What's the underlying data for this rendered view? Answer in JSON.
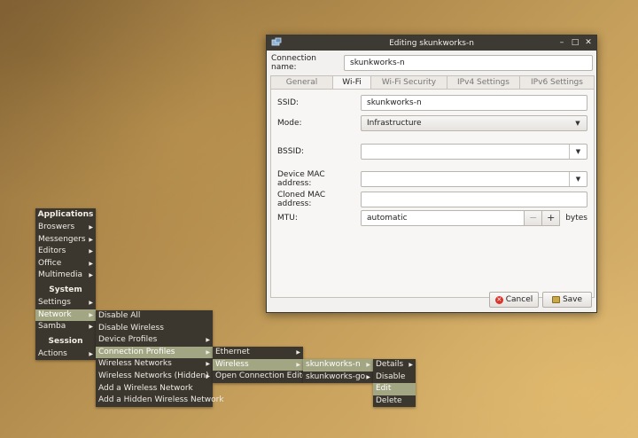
{
  "window": {
    "title": "Editing skunkworks-n",
    "connection_name_label": "Connection name:",
    "connection_name_value": "skunkworks-n",
    "minimize": "–",
    "maximize": "□",
    "close": "✕"
  },
  "tabs": [
    "General",
    "Wi-Fi",
    "Wi-Fi Security",
    "IPv4 Settings",
    "IPv6 Settings"
  ],
  "active_tab": "Wi-Fi",
  "wifi": {
    "ssid_label": "SSID:",
    "ssid_value": "skunkworks-n",
    "mode_label": "Mode:",
    "mode_value": "Infrastructure",
    "bssid_label": "BSSID:",
    "bssid_value": "",
    "device_mac_label": "Device MAC address:",
    "device_mac_value": "",
    "cloned_mac_label": "Cloned MAC address:",
    "cloned_mac_value": "",
    "mtu_label": "MTU:",
    "mtu_value": "automatic",
    "mtu_minus": "−",
    "mtu_plus": "+",
    "mtu_unit": "bytes"
  },
  "buttons": {
    "cancel": "Cancel",
    "save": "Save"
  },
  "icons": {
    "cancel": "✕",
    "dropdown_arrow": "▼",
    "submenu_arrow": "▶"
  },
  "menu_root": {
    "applications_header": "Applications",
    "applications": [
      "Broswers",
      "Messengers",
      "Editors",
      "Office",
      "Multimedia"
    ],
    "system_header": "System",
    "system": [
      "Settings",
      "Network",
      "Samba"
    ],
    "session_header": "Session",
    "session": [
      "Actions"
    ]
  },
  "menu_network": [
    "Disable All",
    "Disable Wireless",
    "Device Profiles",
    "Connection Profiles",
    "Wireless Networks",
    "Wireless Networks (Hidden)",
    "Add a Wireless Network",
    "Add a Hidden Wireless Network"
  ],
  "menu_profiles": [
    "Ethernet",
    "Wireless",
    "Open Connection Editor"
  ],
  "menu_wireless": [
    "skunkworks-n",
    "skunkworks-go"
  ],
  "menu_actions": [
    "Details",
    "Disable",
    "Edit",
    "Delete"
  ],
  "colors": {
    "menu_bg": "#3b372f",
    "menu_highlight": "#a3a683",
    "titlebar": "#3d3933"
  }
}
